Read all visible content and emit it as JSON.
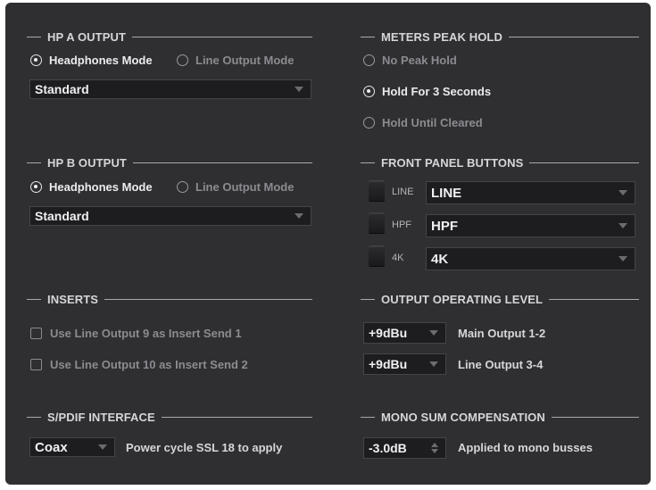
{
  "hp_a": {
    "title": "HP A OUTPUT",
    "mode_headphones": "Headphones Mode",
    "mode_line": "Line Output Mode",
    "select_value": "Standard"
  },
  "hp_b": {
    "title": "HP B OUTPUT",
    "mode_headphones": "Headphones Mode",
    "mode_line": "Line Output Mode",
    "select_value": "Standard"
  },
  "inserts": {
    "title": "INSERTS",
    "option1": "Use Line Output 9 as Insert Send 1",
    "option2": "Use Line Output 10 as Insert Send 2"
  },
  "spdif": {
    "title": "S/PDIF INTERFACE",
    "select_value": "Coax",
    "note": "Power cycle SSL 18 to apply"
  },
  "meters": {
    "title": "METERS PEAK HOLD",
    "options": [
      "No Peak Hold",
      "Hold For 3 Seconds",
      "Hold Until Cleared"
    ],
    "selected": "Hold For 3 Seconds"
  },
  "front_panel": {
    "title": "FRONT PANEL BUTTONS",
    "buttons": [
      {
        "label": "LINE",
        "value": "LINE"
      },
      {
        "label": "HPF",
        "value": "HPF"
      },
      {
        "label": "4K",
        "value": "4K"
      }
    ]
  },
  "output_level": {
    "title": "OUTPUT OPERATING LEVEL",
    "rows": [
      {
        "value": "+9dBu",
        "label": "Main Output 1-2"
      },
      {
        "value": "+9dBu",
        "label": "Line Output 3-4"
      }
    ]
  },
  "mono_sum": {
    "title": "MONO SUM COMPENSATION",
    "value": "-3.0dB",
    "label": "Applied to mono busses"
  },
  "colors": {
    "panel_bg": "#2f2f32",
    "control_bg": "#1d1d20",
    "active_text": "#ececee",
    "inactive_text": "#8b8b90"
  }
}
